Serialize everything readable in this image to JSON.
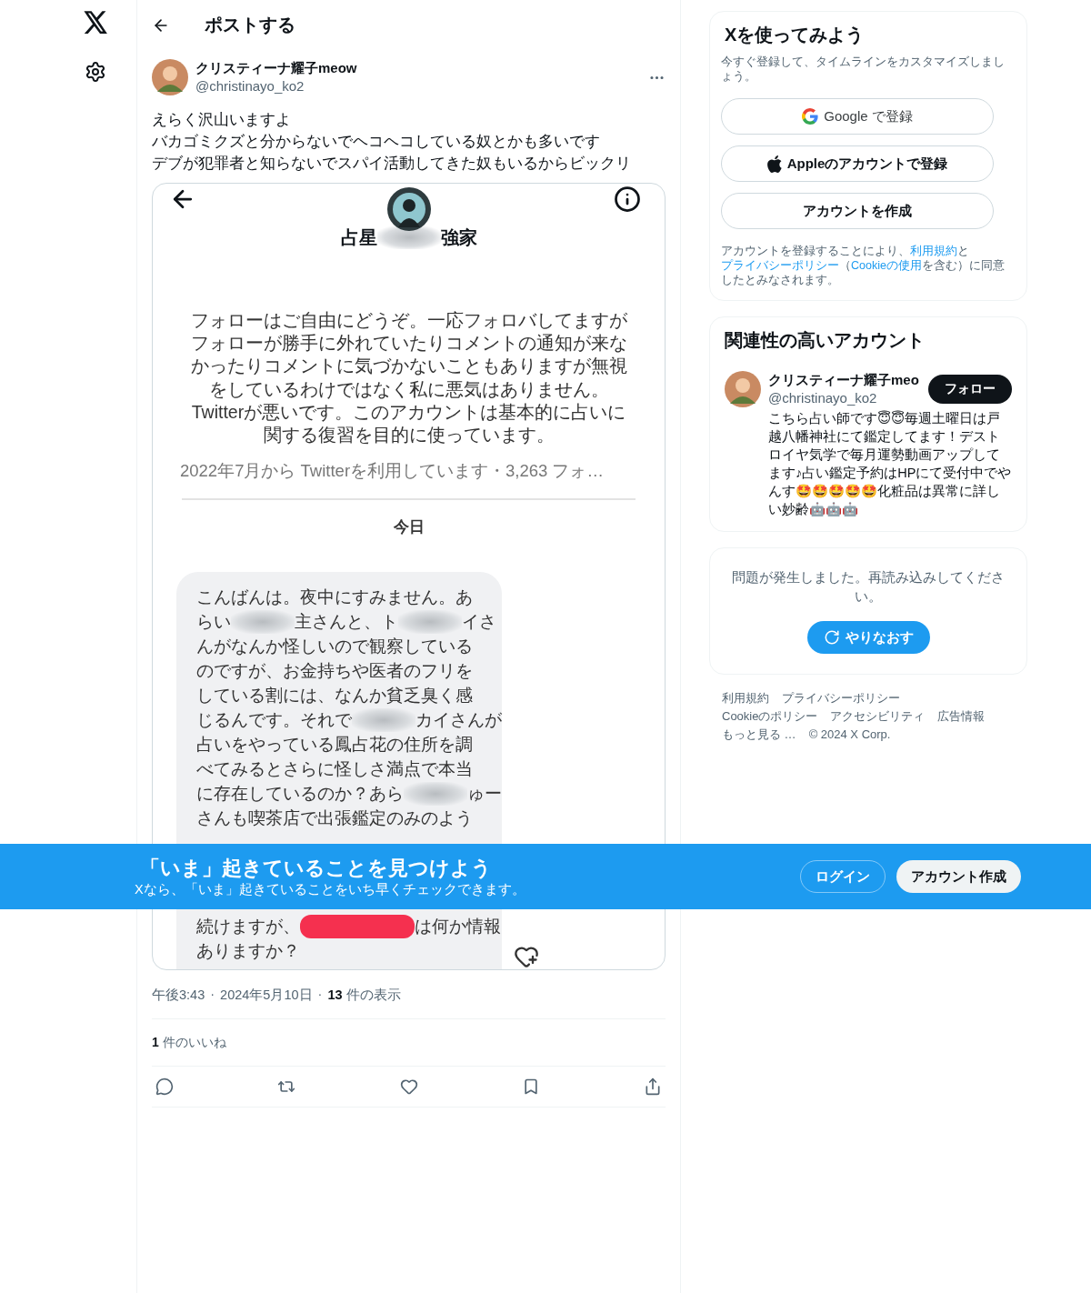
{
  "header": {
    "title": "ポストする"
  },
  "post": {
    "author": {
      "name": "クリスティーナ耀子meow",
      "handle": "@christinayo_ko2"
    },
    "text_lines": [
      "えらく沢山いますよ",
      "バカゴミクズと分からないでヘコヘコしている奴とかも多いです",
      "デブが犯罪者と知らないでスパイ活動してきた奴もいるからビックリ"
    ],
    "attachment": {
      "profile_name": [
        {
          "kind": "text",
          "text": "占星"
        },
        {
          "kind": "blur"
        },
        {
          "kind": "text",
          "text": "強家"
        }
      ],
      "bio": "フォローはご自由にどうぞ。一応フォロバしてますがフォローが勝手に外れていたりコメントの通知が来なかったりコメントに気づかないこともありますが無視をしているわけではなく私に悪気はありません。Twitterが悪いです。このアカウントは基本的に占いに関する復習を目的に使っています。",
      "meta": "2022年7月から Twitterを利用しています・3,263 フォ…",
      "day_label": "今日",
      "message_lines": [
        [
          {
            "kind": "text",
            "text": "こんばんは。夜中にすみません。あ"
          }
        ],
        [
          {
            "kind": "text",
            "text": "らい"
          },
          {
            "kind": "blur"
          },
          {
            "kind": "text",
            "text": "主さんと、ト"
          },
          {
            "kind": "blur"
          },
          {
            "kind": "text",
            "text": "イさ"
          }
        ],
        [
          {
            "kind": "text",
            "text": "んがなんか怪しいので観察している"
          }
        ],
        [
          {
            "kind": "text",
            "text": "のですが、お金持ちや医者のフリを"
          }
        ],
        [
          {
            "kind": "text",
            "text": "している割には、なんか貧乏臭く感"
          }
        ],
        [
          {
            "kind": "text",
            "text": "じるんです。それで"
          },
          {
            "kind": "blur"
          },
          {
            "kind": "text",
            "text": "カイさんが"
          }
        ],
        [
          {
            "kind": "text",
            "text": "占いをやっている鳳占花の住所を調"
          }
        ],
        [
          {
            "kind": "text",
            "text": "べてみるとさらに怪しさ満点で本当"
          }
        ],
        [
          {
            "kind": "text",
            "text": "に存在しているのか？あら"
          },
          {
            "kind": "blur"
          },
          {
            "kind": "text",
            "text": "ゅー"
          }
        ],
        [
          {
            "kind": "text",
            "text": "さんも喫茶店で出張鑑定のみのよう"
          }
        ]
      ],
      "message_lines_after_cover": [
        [
          {
            "kind": "text",
            "text": "続けますが、"
          },
          {
            "kind": "redact"
          },
          {
            "kind": "text",
            "text": "は何か情報"
          }
        ],
        [
          {
            "kind": "text",
            "text": "ありますか？"
          }
        ]
      ]
    },
    "time": "午後3:43",
    "separator": "·",
    "date": "2024年5月10日",
    "views": "**13** 件の表示",
    "likes": "**1** 件のいいね"
  },
  "signup": {
    "title": "Xを使ってみよう",
    "subtitle": "今すぐ登録して、タイムラインをカスタマイズしましょう。",
    "buttons": [
      {
        "kind": "google",
        "label": "Google で登録"
      },
      {
        "kind": "apple",
        "label": "Appleのアカウントで登録"
      },
      {
        "kind": "plain",
        "label": "アカウントを作成"
      }
    ],
    "legal": [
      {
        "kind": "text",
        "text": "アカウントを登録することにより、"
      },
      {
        "kind": "link",
        "text": "利用規約"
      },
      {
        "kind": "text",
        "text": "と"
      },
      {
        "kind": "link",
        "text": "プライバシーポリシー"
      },
      {
        "kind": "text",
        "text": "（"
      },
      {
        "kind": "link",
        "text": "Cookieの使用"
      },
      {
        "kind": "text",
        "text": "を含む）に同意したとみなされます。"
      }
    ]
  },
  "related": {
    "title": "関連性の高いアカウント",
    "account": {
      "name": "クリスティーナ耀子meo",
      "handle": "@christinayo_ko2",
      "follow_label": "フォロー",
      "bio": "こちら占い師です😇😇毎週土曜日は戸越八幡神社にて鑑定してます！デストロイヤ気学で毎月運勢動画アップしてます♪占い鑑定予約はHPにて受付中でやんす🤩🤩🤩🤩🤩化粧品は異常に詳しい妙齢🤖🤖🤖"
    }
  },
  "error_card": {
    "message": "問題が発生しました。再読み込みしてください。",
    "retry_label": "やりなおす"
  },
  "footer_links": [
    "利用規約",
    "プライバシーポリシー",
    "Cookieのポリシー",
    "アクセシビリティ",
    "広告情報",
    "もっと見る …",
    "© 2024 X Corp."
  ],
  "banner": {
    "title": "「いま」起きていることを見つけよう",
    "subtitle": "Xなら、「いま」起きていることをいち早くチェックできます。",
    "login_label": "ログイン",
    "signup_label": "アカウント作成"
  }
}
